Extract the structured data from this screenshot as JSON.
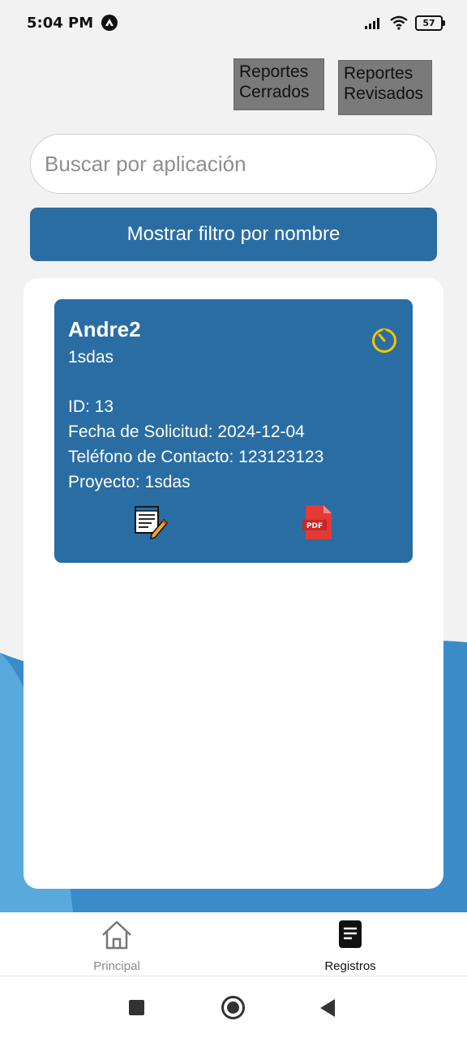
{
  "status_bar": {
    "time": "5:04 PM",
    "battery": "57"
  },
  "header": {
    "cerrados_line1": "Reportes",
    "cerrados_line2": "Cerrados",
    "revisados_line1": "Reportes",
    "revisados_line2": "Revisados"
  },
  "search": {
    "placeholder": "Buscar por aplicación"
  },
  "filter_button": {
    "label": "Mostrar filtro por nombre"
  },
  "card": {
    "name": "Andre2",
    "subtitle": "1sdas",
    "id": "ID: 13",
    "fecha": "Fecha de Solicitud: 2024-12-04",
    "telefono": "Teléfono de Contacto: 123123123",
    "proyecto": "Proyecto: 1sdas",
    "icons": {
      "status": "timer-icon",
      "edit": "edit-document-icon",
      "pdf": "pdf-file-icon"
    }
  },
  "bottom_nav": {
    "principal": "Principal",
    "registros": "Registros"
  },
  "colors": {
    "primary": "#2a6da3",
    "wave_light": "#5aa9dc",
    "wave_dark": "#3a8cc8",
    "timer": "#f2c500",
    "pdf": "#e53935"
  }
}
